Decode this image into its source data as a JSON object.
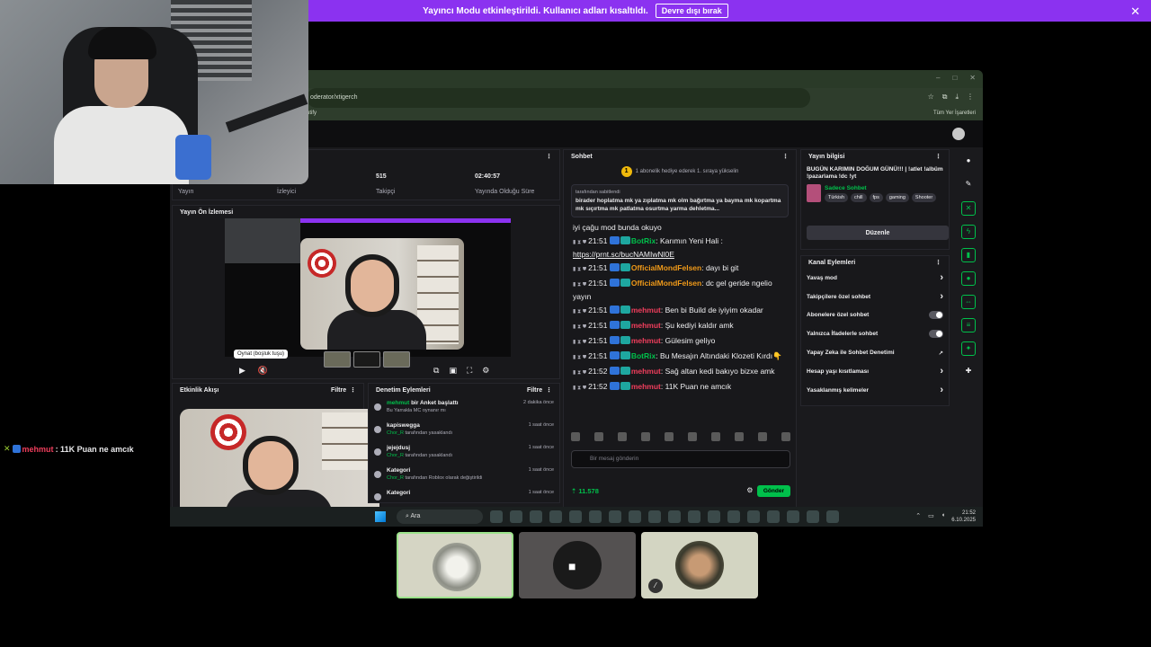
{
  "banner": {
    "message": "Yayıncı Modu etkinleştirildi. Kullanıcı adları kısaltıldı.",
    "button": "Devre dışı bırak",
    "close": "✕"
  },
  "side_chat": {
    "username": "mehmut",
    "message": ": 11K Puan ne amcık",
    "color": "#ef3e5c"
  },
  "browser": {
    "url": "oderator/xtigerch",
    "bookmark_left": "utify",
    "bookmark_right": "Tüm Yer İşaretleri"
  },
  "stats": {
    "stream_label": "Yayın",
    "viewers_label": "İzleyici",
    "followers_value": "515",
    "followers_label": "Takipçi",
    "uptime_value": "02:40:57",
    "uptime_label": "Yayında Olduğu Süre"
  },
  "preview": {
    "title": "Yayın Ön İzlemesi",
    "tooltip": "Oynat (boşluk tuşu)"
  },
  "activity": {
    "title": "Etkinlik Akışı",
    "filter": "Filtre"
  },
  "mod_actions": {
    "title": "Denetim Eylemleri",
    "filter": "Filtre",
    "items": [
      {
        "user": "mehmut",
        "action": " bir Anket başlattı",
        "sub": "Bu Yarrakla MC oynanır mı",
        "time": "2 dakika önce"
      },
      {
        "user": "kapiswegga",
        "action": "",
        "sub_user": "Chor_R",
        "sub": " tarafından yasaklandı",
        "time": "1 saat önce"
      },
      {
        "user": "jejejdusj",
        "action": "",
        "sub_user": "Chor_R",
        "sub": " tarafından yasaklandı",
        "time": "1 saat önce"
      },
      {
        "user": "Kategori",
        "action": "",
        "sub_user": "Chor_R",
        "sub": " tarafından Roblox olarak değiştirildi",
        "time": "1 saat önce"
      },
      {
        "user": "Kategori",
        "action": "",
        "sub_user": "",
        "sub": "",
        "time": "1 saat önce"
      }
    ]
  },
  "chat": {
    "title": "Sohbet",
    "gift_banner": "1 abonelik hediye ederek 1. sıraya yükselin",
    "pinned_by": "tarafından sabitlendi",
    "pinned_text": "birader hoplatma mk ya zıplatma mk olm bağırtma ya bayma mk kopartma mk sıçırtma mk patlatma osurtma yarma dehletma...",
    "first_line": "iyi çağu mod bunda okuyo",
    "messages": [
      {
        "time": "21:51",
        "user": "BotRix",
        "color": "green",
        "text": ": Karımın Yeni Hali : ",
        "link": "https://prnt.sc/bucNAMIwNl0E"
      },
      {
        "time": "21:51",
        "user": "OfficialMondFelsen",
        "color": "orange",
        "text": ": dayı bi git"
      },
      {
        "time": "21:51",
        "user": "OfficialMondFelsen",
        "color": "orange",
        "text": ": dc gel geride ngelio yayın"
      },
      {
        "time": "21:51",
        "user": "mehmut",
        "color": "red",
        "text": ": Ben bi Build de iyiyim okadar"
      },
      {
        "time": "21:51",
        "user": "mehmut",
        "color": "red",
        "text": ": Şu kediyi kaldır amk"
      },
      {
        "time": "21:51",
        "user": "mehmut",
        "color": "red",
        "text": ": Gülesim geliyo"
      },
      {
        "time": "21:51",
        "user": "BotRix",
        "color": "green",
        "text": ": Bu Mesajın Altındaki Klozeti Kırdı👇"
      },
      {
        "time": "21:52",
        "user": "mehmut",
        "color": "red",
        "text": ": Sağ altan kedi bakıyo bizxe amk"
      },
      {
        "time": "21:52",
        "user": "mehmut",
        "color": "red",
        "text": ": 11K Puan ne amcık"
      }
    ],
    "input_placeholder": "Bir mesaj gönderin",
    "points": "11.578",
    "send": "Gönder"
  },
  "stream_info": {
    "title_label": "Yayın bilgisi",
    "stream_title": "BUGÜN KARIMIN DOĞUM GÜNÜ!!! | !atlet !albüm !pazarlama !dc !yt",
    "category": "Sadece Sohbet",
    "tags": [
      "Türkish",
      "chill",
      "fps",
      "gaming",
      "Shooter"
    ],
    "edit": "Düzenle"
  },
  "channel_actions": {
    "title": "Kanal Eylemleri",
    "items": [
      {
        "label": "Yavaş mod",
        "kind": "chevron"
      },
      {
        "label": "Takipçilere özel sohbet",
        "kind": "chevron"
      },
      {
        "label": "Abonelere özel sohbet",
        "kind": "toggle"
      },
      {
        "label": "Yalnızca İfadelerle sohbet",
        "kind": "toggle"
      },
      {
        "label": "Yapay Zeka ile Sohbet Denetimi",
        "kind": "external"
      },
      {
        "label": "Hesap yaşı kısıtlaması",
        "kind": "chevron"
      },
      {
        "label": "Yasaklanmış kelimeler",
        "kind": "chevron"
      }
    ]
  },
  "taskbar": {
    "search": "Ara",
    "time": "21:52",
    "date": "6.10.2025"
  },
  "colors": {
    "accent": "#00c04b",
    "banner": "#8b32f0"
  }
}
